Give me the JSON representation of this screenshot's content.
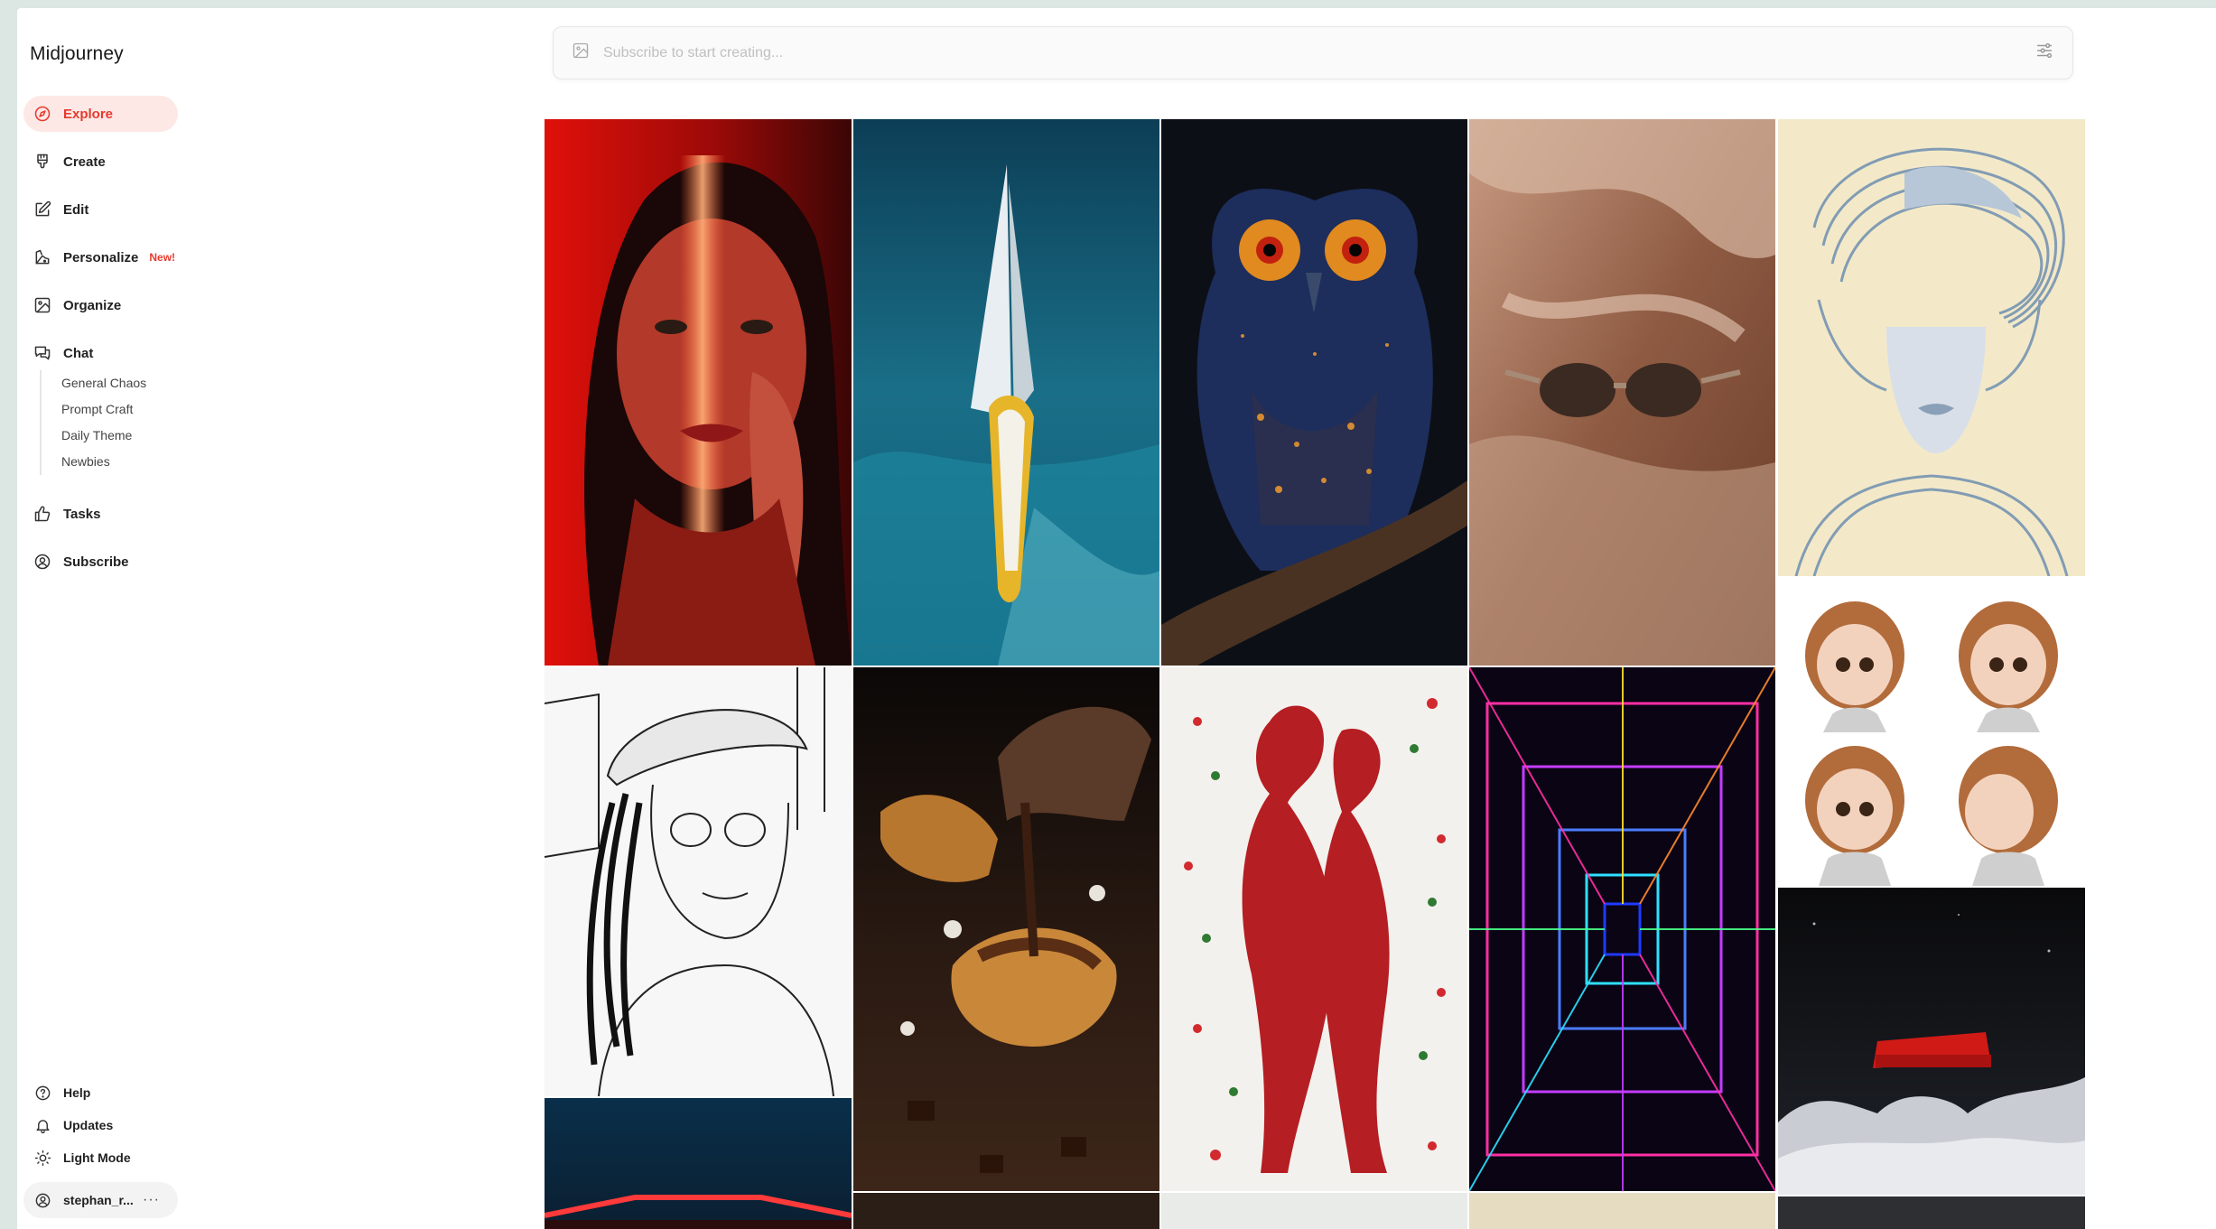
{
  "app": {
    "name": "Midjourney"
  },
  "sidebar": {
    "items": [
      {
        "label": "Explore",
        "icon": "compass-icon",
        "active": true
      },
      {
        "label": "Create",
        "icon": "brush-icon"
      },
      {
        "label": "Edit",
        "icon": "edit-icon"
      },
      {
        "label": "Personalize",
        "icon": "palette-icon",
        "badge": "New!"
      },
      {
        "label": "Organize",
        "icon": "image-icon"
      },
      {
        "label": "Chat",
        "icon": "chat-icon"
      },
      {
        "label": "Tasks",
        "icon": "thumbs-up-icon"
      },
      {
        "label": "Subscribe",
        "icon": "user-circle-icon"
      }
    ],
    "chat_channels": [
      "General Chaos",
      "Prompt Craft",
      "Daily Theme",
      "Newbies"
    ],
    "bottom": [
      {
        "label": "Help",
        "icon": "help-icon"
      },
      {
        "label": "Updates",
        "icon": "bell-icon"
      },
      {
        "label": "Light Mode",
        "icon": "sun-icon"
      }
    ],
    "user": {
      "name": "stephan_r...",
      "more": "···"
    }
  },
  "search": {
    "placeholder": "Subscribe to start creating..."
  },
  "colors": {
    "accent": "#e63b2e",
    "active_bg": "#fde8e6",
    "frame": "#dce6e2"
  },
  "gallery": [
    {
      "name": "gallery-image-portrait-red-light"
    },
    {
      "name": "gallery-image-sailboat-ocean"
    },
    {
      "name": "gallery-image-owl-starry"
    },
    {
      "name": "gallery-image-sunglasses-clay"
    },
    {
      "name": "gallery-image-line-art-woman"
    },
    {
      "name": "gallery-image-sketch-girl-cap"
    },
    {
      "name": "gallery-image-chocolate-croissant"
    },
    {
      "name": "gallery-image-rose-couple"
    },
    {
      "name": "gallery-image-neon-tunnel"
    },
    {
      "name": "gallery-image-cartoon-girl-faces"
    },
    {
      "name": "gallery-image-red-sofa-clouds"
    },
    {
      "name": "gallery-image-neon-sign-night"
    }
  ]
}
